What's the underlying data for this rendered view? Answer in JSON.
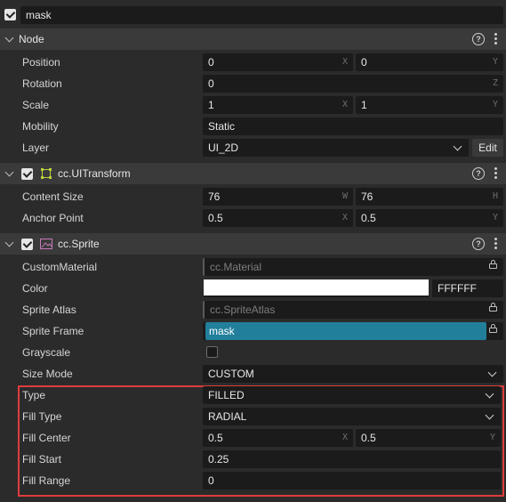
{
  "node": {
    "enabled": true,
    "name": "mask"
  },
  "sections": {
    "node": {
      "title": "Node"
    },
    "uitransform": {
      "title": "cc.UITransform"
    },
    "sprite": {
      "title": "cc.Sprite"
    }
  },
  "node_props": {
    "position": {
      "label": "Position",
      "x": "0",
      "y": "0",
      "x_axis": "X",
      "y_axis": "Y"
    },
    "rotation": {
      "label": "Rotation",
      "z": "0",
      "z_axis": "Z"
    },
    "scale": {
      "label": "Scale",
      "x": "1",
      "y": "1",
      "x_axis": "X",
      "y_axis": "Y"
    },
    "mobility": {
      "label": "Mobility",
      "value": "Static"
    },
    "layer": {
      "label": "Layer",
      "value": "UI_2D",
      "edit_label": "Edit"
    }
  },
  "uitransform_props": {
    "content_size": {
      "label": "Content Size",
      "w": "76",
      "h": "76",
      "w_axis": "W",
      "h_axis": "H"
    },
    "anchor_point": {
      "label": "Anchor Point",
      "x": "0.5",
      "y": "0.5",
      "x_axis": "X",
      "y_axis": "Y"
    }
  },
  "sprite_props": {
    "custom_material": {
      "label": "CustomMaterial",
      "placeholder": "cc.Material"
    },
    "color": {
      "label": "Color",
      "hex": "FFFFFF",
      "swatch": "#ffffff"
    },
    "sprite_atlas": {
      "label": "Sprite Atlas",
      "placeholder": "cc.SpriteAtlas"
    },
    "sprite_frame": {
      "label": "Sprite Frame",
      "value": "mask"
    },
    "grayscale": {
      "label": "Grayscale",
      "checked": false
    },
    "size_mode": {
      "label": "Size Mode",
      "value": "CUSTOM"
    },
    "type": {
      "label": "Type",
      "value": "FILLED"
    },
    "fill_type": {
      "label": "Fill Type",
      "value": "RADIAL"
    },
    "fill_center": {
      "label": "Fill Center",
      "x": "0.5",
      "y": "0.5",
      "x_axis": "X",
      "y_axis": "Y"
    },
    "fill_start": {
      "label": "Fill Start",
      "value": "0.25"
    },
    "fill_range": {
      "label": "Fill Range",
      "value": "0"
    }
  },
  "icons": {
    "help": "help-icon",
    "menu": "kebab-menu-icon",
    "uitransform": "uitransform-icon",
    "sprite": "sprite-icon",
    "lock": "lock-icon"
  },
  "colors": {
    "background": "#2b2b2b",
    "header": "#3a3a3a",
    "field": "#1b1b1b",
    "sprite_frame_field": "#227f9c",
    "highlight_border": "#e03c3c",
    "uitransform_icon": "#b6d23b",
    "sprite_icon": "#c57bb8"
  }
}
